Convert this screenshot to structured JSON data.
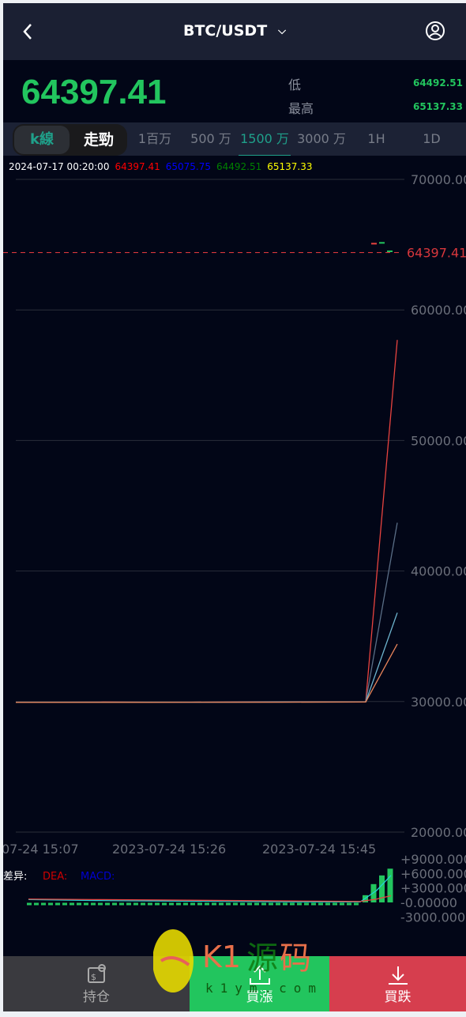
{
  "header": {
    "title": "BTC/USDT",
    "back_icon": "chevron-left-icon",
    "dropdown_icon": "chevron-down-icon",
    "user_icon": "user-circle-icon"
  },
  "ticker": {
    "last_price": "64397.41",
    "low_label": "低",
    "low_value": "64492.51",
    "high_label": "最高",
    "high_value": "65137.33"
  },
  "tabs": {
    "mode": [
      {
        "label": "k線",
        "active": true
      },
      {
        "label": "走勁",
        "active": false
      }
    ],
    "intervals": [
      {
        "label": "1百万"
      },
      {
        "label": "500 万"
      },
      {
        "label": "1500 万",
        "active": true
      },
      {
        "label": "3000 万"
      },
      {
        "label": "1H"
      },
      {
        "label": "1D"
      }
    ]
  },
  "ohlc_info": {
    "time": "2024-07-17 00:20:00",
    "v1": "64397.41",
    "v2": "65075.75",
    "v3": "64492.51",
    "v4": "65137.33",
    "colors": [
      "#ff0000",
      "#0000ff",
      "#008000",
      "#ffff00"
    ]
  },
  "chart_data": [
    {
      "type": "line",
      "ylim": [
        20000,
        70000
      ],
      "yticks": [
        "70000.00",
        "60000.00",
        "50000.00",
        "40000.00",
        "30000.00",
        "20000.00"
      ],
      "xticks": [
        "07-24 15:07",
        "2023-07-24 15:26",
        "2023-07-24 15:45"
      ],
      "current_price_line": {
        "value": 64397.41,
        "label": "64397.41",
        "color": "#d8373c"
      },
      "grid": true,
      "series": [
        {
          "color": "#e8433f",
          "values": [
            29950,
            29950,
            29960,
            29950,
            29950,
            29960,
            29970,
            29980,
            29980,
            57700
          ]
        },
        {
          "color": "#5a6e86",
          "values": [
            29950,
            29950,
            29950,
            29950,
            29950,
            29960,
            29960,
            29970,
            29980,
            43700
          ]
        },
        {
          "color": "#6fb6d0",
          "values": [
            29950,
            29950,
            29950,
            29950,
            29950,
            29950,
            29960,
            29960,
            29970,
            36800
          ]
        },
        {
          "color": "#e8845a",
          "values": [
            29940,
            29940,
            29940,
            29940,
            29950,
            29950,
            29950,
            29960,
            29970,
            34400
          ]
        }
      ],
      "candles": [
        {
          "o": 65075.75,
          "c": 65075.75,
          "color": "#e8433f"
        },
        {
          "o": 65137.33,
          "c": 65075.75,
          "color": "#22c55e"
        },
        {
          "o": 64492.51,
          "c": 64397.41,
          "color": "#22c55e"
        }
      ]
    },
    {
      "type": "bar",
      "legend": [
        {
          "label": "差异:",
          "color": "#ffffff"
        },
        {
          "label": "DEA:",
          "color": "#d00000"
        },
        {
          "label": "MACD:",
          "color": "#0000d0"
        }
      ],
      "ylim": [
        -3000,
        9000
      ],
      "yticks": [
        "+9000.0000",
        "+6000.0000",
        "+3000.0000",
        "-0.00000",
        "-3000.0000"
      ],
      "bars": [
        1500,
        3800,
        5600,
        7000
      ],
      "bar_color": "#22c55e",
      "dif": [
        600,
        400,
        300,
        200,
        100,
        100,
        2500,
        5600
      ],
      "dea": [
        700,
        600,
        500,
        400,
        300,
        200,
        700,
        1400
      ]
    }
  ],
  "actions": {
    "positions_label": "持仓",
    "positions_icon": "money-search-icon",
    "buy_up_label": "買漲",
    "buy_up_icon": "upload-icon",
    "buy_down_label": "買跌",
    "buy_down_icon": "download-icon",
    "colors": {
      "positions": "#3a3a3f",
      "buy_up": "#22c55e",
      "buy_down": "#d63e4e"
    }
  },
  "watermark": {
    "text": "K1源码",
    "sub": "k1ym.com"
  }
}
